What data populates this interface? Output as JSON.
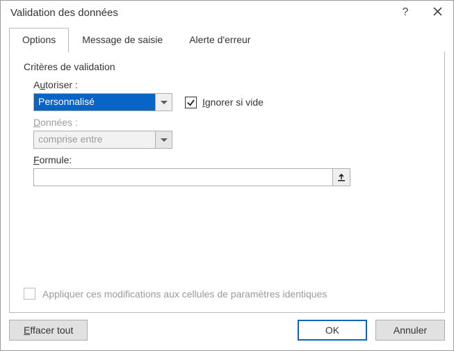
{
  "window": {
    "title": "Validation des données"
  },
  "tabs": [
    {
      "label": "Options",
      "active": true
    },
    {
      "label": "Message de saisie",
      "active": false
    },
    {
      "label": "Alerte d'erreur",
      "active": false
    }
  ],
  "section": {
    "title": "Critères de validation"
  },
  "allow": {
    "label_pre": "A",
    "label_u": "u",
    "label_post": "toriser :",
    "value": "Personnalisé"
  },
  "ignore_blank": {
    "label_pre": "",
    "label_u": "I",
    "label_post": "gnorer si vide",
    "checked": true
  },
  "data_field": {
    "label_pre": "",
    "label_u": "D",
    "label_post": "onnées :",
    "value": "comprise entre",
    "disabled": true
  },
  "formula": {
    "label_pre": "",
    "label_u": "F",
    "label_post": "ormule:",
    "value": ""
  },
  "apply_same": {
    "label": "Appliquer ces modifications aux cellules de paramètres identiques",
    "checked": false,
    "disabled": true
  },
  "buttons": {
    "clear_pre": "",
    "clear_u": "E",
    "clear_post": "ffacer tout",
    "ok": "OK",
    "cancel": "Annuler"
  }
}
